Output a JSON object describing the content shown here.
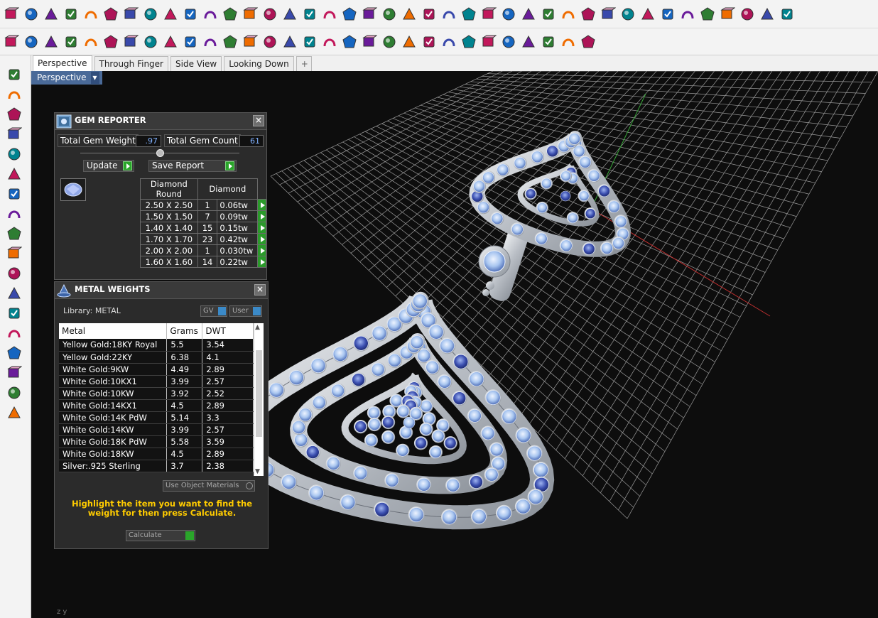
{
  "toolbar_top": {
    "icons": [
      "box-icon",
      "sphere-tools-icon",
      "cube-grid-icon",
      "cube-wire-icon",
      "curve-tool-icon",
      "ring-icon",
      "transform-icon",
      "shank-icon",
      "magnet-icon",
      "bezel-icon",
      "prong-icon",
      "cage-icon",
      "frame-icon",
      "gem-cut-icon",
      "stone-icon",
      "array-icon",
      "check-icon",
      "grid-icon",
      "settings-icon",
      "fix-icon",
      "flame-icon",
      "pave-icon",
      "arrow-icon",
      "stack-icon",
      "dots-icon",
      "curve-arc-icon",
      "spark-icon",
      "branch-icon",
      "fork-icon",
      "gem-flat-icon",
      "target-icon",
      "star-icon",
      "pentagon-icon",
      "comb-icon",
      "plane-icon",
      "panel-icon",
      "grid-panel-icon",
      "cross-icon",
      "cube-dark-icon",
      "gear-icon"
    ]
  },
  "toolbar_second": {
    "icons": [
      "save-icon",
      "print-icon",
      "new-icon",
      "cut-icon",
      "copy-icon",
      "paste-icon",
      "undo-icon",
      "pan-hand-icon",
      "move-icon",
      "zoom-icon",
      "zoom-window-icon",
      "zoom-extents-icon",
      "zoom-selected-icon",
      "rotate-view-icon",
      "grid-viewports-icon",
      "car-icon",
      "render-icon",
      "clock-icon",
      "point-icon",
      "light-bulb-icon",
      "lock-icon",
      "layer-icon",
      "color-wheel-icon",
      "sphere-icon",
      "sphere-wire-icon",
      "sphere-blue-icon",
      "paint-icon",
      "gear-cog-icon",
      "snap-icon",
      "help-icon"
    ]
  },
  "left_toolbar": {
    "icons": [
      "point-tool-icon",
      "polyline-tool-icon",
      "circle-tool-icon",
      "rectangle-tool-icon",
      "arc-tool-icon",
      "surface-tool-icon",
      "solid-tool-icon",
      "mesh-tool-icon",
      "transform-tool-icon",
      "dimension-tool-icon",
      "analyze-tool-icon",
      "curve-edit-icon",
      "scale-tool-icon",
      "render-tool-icon",
      "array-tool-icon",
      "group-tool-icon",
      "check-tool-icon",
      "paint-tool-icon"
    ]
  },
  "tabs": [
    {
      "label": "Perspective",
      "active": true
    },
    {
      "label": "Through Finger",
      "active": false
    },
    {
      "label": "Side View",
      "active": false
    },
    {
      "label": "Looking Down",
      "active": false
    },
    {
      "label": "+",
      "active": false
    }
  ],
  "viewport": {
    "label": "Perspective",
    "axis_label": "z y"
  },
  "gem_reporter": {
    "title": "GEM REPORTER",
    "close": "×",
    "total_weight_label": "Total Gem Weight",
    "total_weight_value": ".97",
    "total_count_label": "Total Gem Count",
    "total_count_value": "61",
    "update_label": "Update",
    "save_report_label": "Save Report",
    "table": {
      "headers": [
        "Diamond Round",
        "Diamond"
      ],
      "rows": [
        {
          "size": "2.50 X 2.50",
          "count": "1",
          "weight": "0.06tw"
        },
        {
          "size": "1.50 X 1.50",
          "count": "7",
          "weight": "0.09tw"
        },
        {
          "size": "1.40 X 1.40",
          "count": "15",
          "weight": "0.15tw"
        },
        {
          "size": "1.70 X 1.70",
          "count": "23",
          "weight": "0.42tw"
        },
        {
          "size": "2.00 X 2.00",
          "count": "1",
          "weight": "0.030tw"
        },
        {
          "size": "1.60 X 1.60",
          "count": "14",
          "weight": "0.22tw"
        }
      ]
    }
  },
  "metal_weights": {
    "title": "METAL WEIGHTS",
    "close": "×",
    "library_label": "Library: METAL",
    "gv_label": "GV",
    "user_label": "User",
    "columns": [
      "Metal",
      "Grams",
      "DWT"
    ],
    "rows": [
      {
        "metal": "Yellow Gold:18KY Royal",
        "grams": "5.5",
        "dwt": "3.54"
      },
      {
        "metal": "Yellow Gold:22KY",
        "grams": "6.38",
        "dwt": "4.1"
      },
      {
        "metal": "White Gold:9KW",
        "grams": "4.49",
        "dwt": "2.89"
      },
      {
        "metal": "White Gold:10KX1",
        "grams": "3.99",
        "dwt": "2.57"
      },
      {
        "metal": "White Gold:10KW",
        "grams": "3.92",
        "dwt": "2.52"
      },
      {
        "metal": "White Gold:14KX1",
        "grams": "4.5",
        "dwt": "2.89"
      },
      {
        "metal": "White Gold:14K PdW",
        "grams": "5.14",
        "dwt": "3.3"
      },
      {
        "metal": "White Gold:14KW",
        "grams": "3.99",
        "dwt": "2.57"
      },
      {
        "metal": "White Gold:18K PdW",
        "grams": "5.58",
        "dwt": "3.59"
      },
      {
        "metal": "White Gold:18KW",
        "grams": "4.5",
        "dwt": "2.89"
      },
      {
        "metal": "Silver:.925 Sterling",
        "grams": "3.7",
        "dwt": "2.38"
      }
    ],
    "use_object_materials_label": "Use Object Materials",
    "note": "Highlight the item you want to find the weight for then press Calculate.",
    "calculate_label": "Calculate"
  },
  "colors": {
    "accent": "#4a6a98",
    "note": "#ffcc00",
    "go_button": "#2aa52a",
    "gem": "#a9c6f0",
    "metal": "#cfd3d8"
  }
}
